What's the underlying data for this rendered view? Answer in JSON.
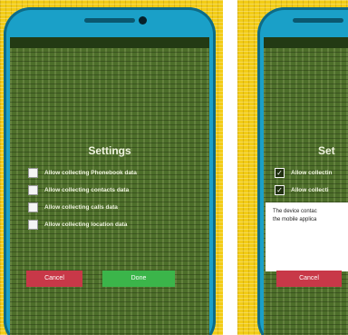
{
  "left_screen": {
    "status_left": "",
    "status_right": "",
    "title": "Settings",
    "options": [
      {
        "label": "Allow collecting Phonebook data",
        "checked": false
      },
      {
        "label": "Allow collecting contacts data",
        "checked": false
      },
      {
        "label": "Allow collecting calls data",
        "checked": false
      },
      {
        "label": "Allow collecting location data",
        "checked": false
      }
    ],
    "cancel_label": "Cancel",
    "done_label": "Done"
  },
  "right_screen": {
    "title": "Set",
    "options": [
      {
        "label": "Allow collectin",
        "checked": true
      },
      {
        "label": "Allow collecti",
        "checked": true
      }
    ],
    "dialog_text_1": "The device contac",
    "dialog_text_2": "the mobile applica",
    "cancel_label": "Cancel"
  },
  "colors": {
    "background": "#f2cc16",
    "phone_frame": "#1aa0c8",
    "screen": "#4d6e2a",
    "cancel_button": "#c83848",
    "done_button": "#3bb54a"
  }
}
